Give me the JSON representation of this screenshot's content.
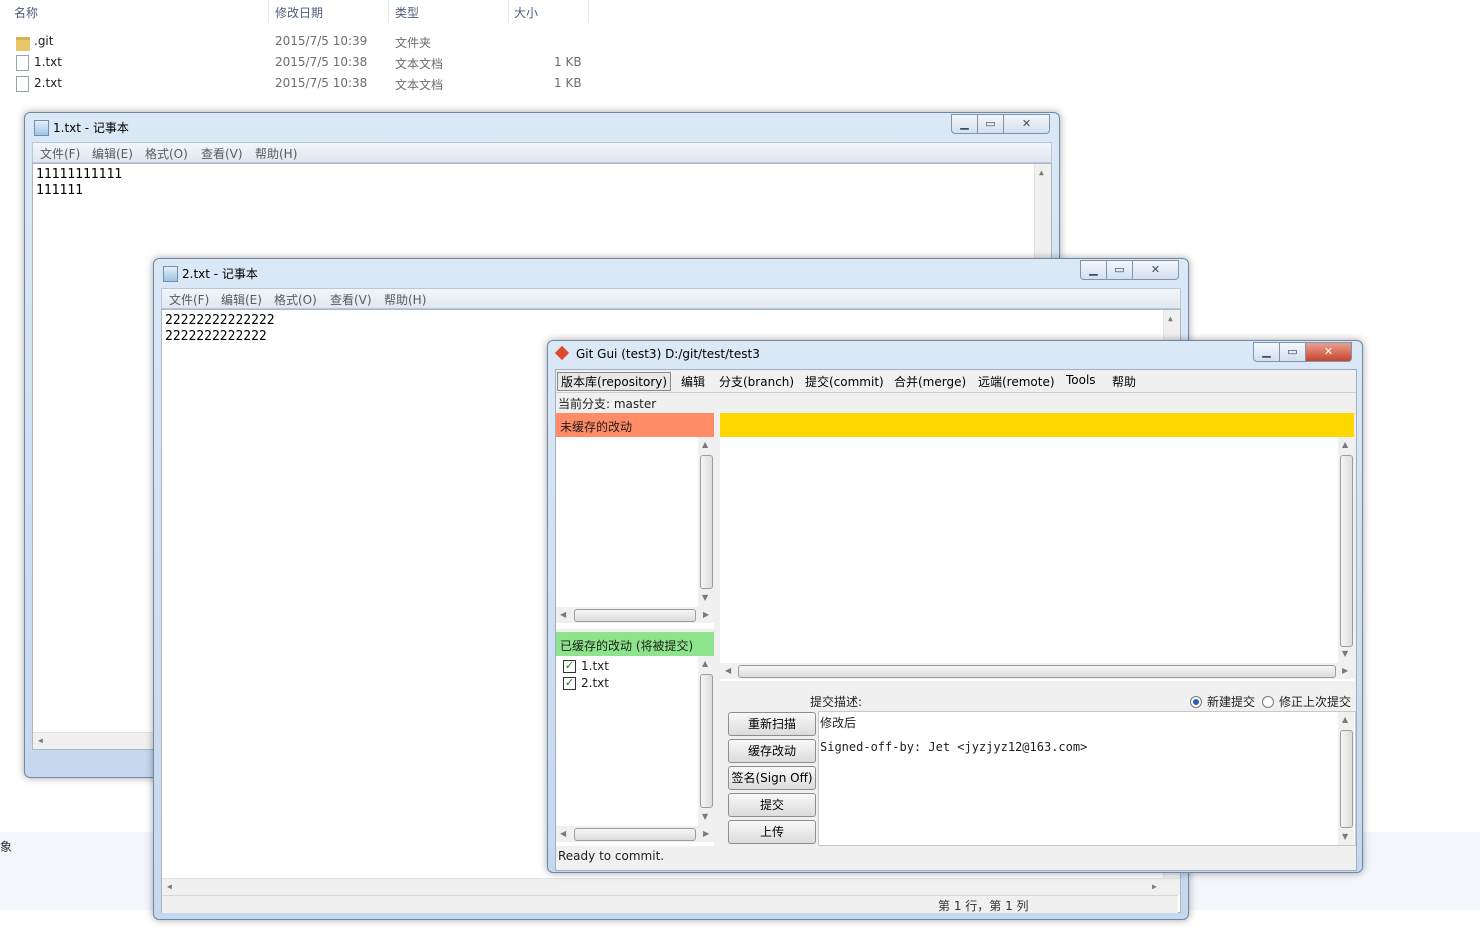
{
  "explorer": {
    "columns": [
      "名称",
      "修改日期",
      "类型",
      "大小"
    ],
    "rows": [
      {
        "name": ".git",
        "date": "2015/7/5 10:39",
        "type": "文件夹",
        "size": ""
      },
      {
        "name": "1.txt",
        "date": "2015/7/5 10:38",
        "type": "文本文档",
        "size": "1 KB"
      },
      {
        "name": "2.txt",
        "date": "2015/7/5 10:38",
        "type": "文本文档",
        "size": "1 KB"
      }
    ],
    "left_edge_text": "象"
  },
  "notepad1": {
    "title": "1.txt - 记事本",
    "menu": [
      "文件(F)",
      "编辑(E)",
      "格式(O)",
      "查看(V)",
      "帮助(H)"
    ],
    "lines": [
      "11111111111",
      "111111"
    ]
  },
  "notepad2": {
    "title": "2.txt - 记事本",
    "menu": [
      "文件(F)",
      "编辑(E)",
      "格式(O)",
      "查看(V)",
      "帮助(H)"
    ],
    "lines": [
      "22222222222222",
      "2222222222222"
    ],
    "status": "第 1 行，第 1 列"
  },
  "gitgui": {
    "title": "Git Gui (test3) D:/git/test/test3",
    "menu": [
      "版本库(repository)",
      "编辑",
      "分支(branch)",
      "提交(commit)",
      "合并(merge)",
      "远端(remote)",
      "Tools",
      "帮助"
    ],
    "branch_label": "当前分支: master",
    "unstaged_header": "未缓存的改动",
    "staged_header": "已缓存的改动 (将被提交)",
    "staged_files": [
      "1.txt",
      "2.txt"
    ],
    "commit_label": "提交描述:",
    "radio_new": "新建提交",
    "radio_amend": "修正上次提交",
    "buttons": {
      "rescan": "重新扫描",
      "stage": "缓存改动",
      "signoff": "签名(Sign Off)",
      "commit": "提交",
      "push": "上传"
    },
    "message_line1": "修改后",
    "message_line2": "Signed-off-by: Jet <jyzjyz12@163.com>",
    "status": "Ready to commit.",
    "colors": {
      "unstaged": "#ff8c66",
      "staged": "#8ee48c",
      "diff_header": "#ffd700"
    }
  }
}
